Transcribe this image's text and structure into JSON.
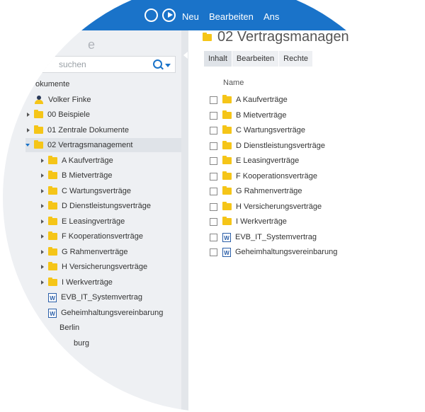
{
  "topbar": {
    "nav_items": [
      "Neu",
      "Bearbeiten",
      "Ans"
    ]
  },
  "sidebar": {
    "title_partial": "e",
    "search_placeholder": "suchen",
    "tree": [
      {
        "label": "okumente",
        "type": "root"
      },
      {
        "label": "Volker Finke",
        "type": "person"
      },
      {
        "label": "00 Beispiele",
        "type": "folder"
      },
      {
        "label": "01 Zentrale Dokumente",
        "type": "folder"
      },
      {
        "label": "02 Vertragsmanagement",
        "type": "folder",
        "expanded": true,
        "selected": true
      },
      {
        "label": "A Kaufverträge",
        "type": "folder"
      },
      {
        "label": "B Mietverträge",
        "type": "folder"
      },
      {
        "label": "C Wartungsverträge",
        "type": "folder"
      },
      {
        "label": "D Dienstleistungsverträge",
        "type": "folder"
      },
      {
        "label": "E Leasingverträge",
        "type": "folder"
      },
      {
        "label": "F Kooperationsverträge",
        "type": "folder"
      },
      {
        "label": "G Rahmenverträge",
        "type": "folder"
      },
      {
        "label": "H Versicherungsverträge",
        "type": "folder"
      },
      {
        "label": "I Werkverträge",
        "type": "folder"
      },
      {
        "label": "EVB_IT_Systemvertrag",
        "type": "word"
      },
      {
        "label": "Geheimhaltungsvereinbarung",
        "type": "word"
      },
      {
        "label": "Berlin",
        "type": "plain"
      },
      {
        "label": "burg",
        "type": "plain"
      }
    ]
  },
  "main": {
    "title": "02 Vertragsmanagen",
    "tabs": [
      "Inhalt",
      "Bearbeiten",
      "Rechte"
    ],
    "column_header": "Name",
    "items": [
      {
        "label": "A Kaufverträge",
        "type": "folder"
      },
      {
        "label": "B Mietverträge",
        "type": "folder"
      },
      {
        "label": "C Wartungsverträge",
        "type": "folder"
      },
      {
        "label": "D Dienstleistungsverträge",
        "type": "folder"
      },
      {
        "label": "E Leasingverträge",
        "type": "folder"
      },
      {
        "label": "F Kooperationsverträge",
        "type": "folder"
      },
      {
        "label": "G Rahmenverträge",
        "type": "folder"
      },
      {
        "label": "H Versicherungsverträge",
        "type": "folder"
      },
      {
        "label": "I Werkverträge",
        "type": "folder"
      },
      {
        "label": "EVB_IT_Systemvertrag",
        "type": "word"
      },
      {
        "label": "Geheimhaltungsvereinbarung",
        "type": "word"
      }
    ]
  },
  "colors": {
    "accent": "#1a73c9",
    "folder": "#f5c518",
    "sidebar_bg": "#eef0f3"
  }
}
